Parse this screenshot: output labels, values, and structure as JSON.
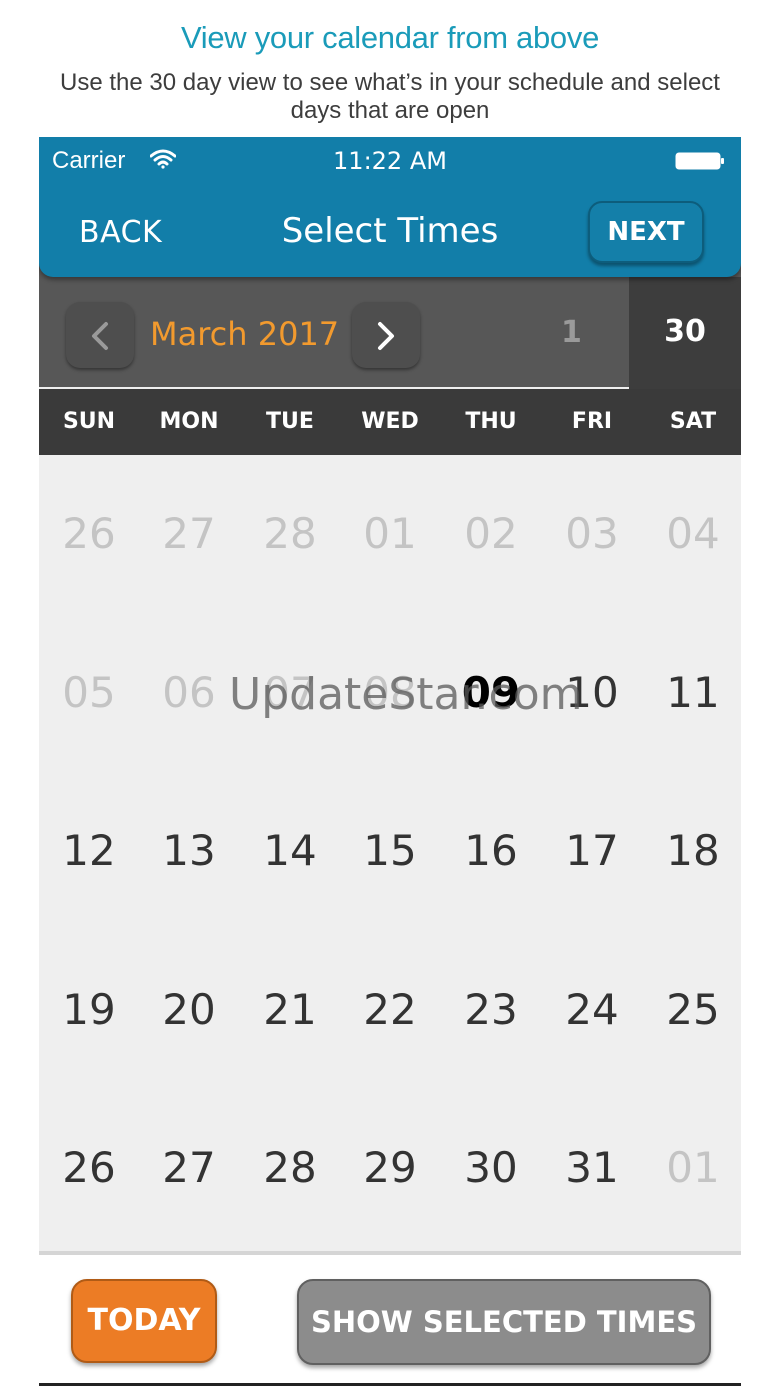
{
  "promo": {
    "title": "View your calendar from above",
    "subtitle": "Use the 30 day view to see what’s in your schedule and select days that are open"
  },
  "status_bar": {
    "carrier": "Carrier",
    "time": "11:22 AM"
  },
  "nav": {
    "back_label": "BACK",
    "title": "Select Times",
    "next_label": "NEXT"
  },
  "calendar": {
    "month_label": "March 2017",
    "view_options": [
      "1",
      "30"
    ],
    "selected_view": "30",
    "weekdays": [
      "SUN",
      "MON",
      "TUE",
      "WED",
      "THU",
      "FRI",
      "SAT"
    ],
    "weeks": [
      [
        {
          "d": "26",
          "o": true
        },
        {
          "d": "27",
          "o": true
        },
        {
          "d": "28",
          "o": true
        },
        {
          "d": "01",
          "o": true
        },
        {
          "d": "02",
          "o": true
        },
        {
          "d": "03",
          "o": true
        },
        {
          "d": "04",
          "o": true
        }
      ],
      [
        {
          "d": "05",
          "o": true
        },
        {
          "d": "06",
          "o": true
        },
        {
          "d": "07",
          "o": true
        },
        {
          "d": "08",
          "o": true
        },
        {
          "d": "09",
          "t": true
        },
        {
          "d": "10"
        },
        {
          "d": "11"
        }
      ],
      [
        {
          "d": "12"
        },
        {
          "d": "13"
        },
        {
          "d": "14"
        },
        {
          "d": "15"
        },
        {
          "d": "16"
        },
        {
          "d": "17"
        },
        {
          "d": "18"
        }
      ],
      [
        {
          "d": "19"
        },
        {
          "d": "20"
        },
        {
          "d": "21"
        },
        {
          "d": "22"
        },
        {
          "d": "23"
        },
        {
          "d": "24"
        },
        {
          "d": "25"
        }
      ],
      [
        {
          "d": "26"
        },
        {
          "d": "27"
        },
        {
          "d": "28"
        },
        {
          "d": "29"
        },
        {
          "d": "30"
        },
        {
          "d": "31"
        },
        {
          "d": "01",
          "o": true
        }
      ]
    ]
  },
  "watermark": "UpdateStar.com",
  "actions": {
    "today_label": "TODAY",
    "show_selected_label": "SHOW SELECTED TIMES"
  },
  "colors": {
    "accent": "#127ea9",
    "month": "#f29a2e",
    "today_button": "#ec7c25",
    "promo_title": "#1a9bb9"
  }
}
